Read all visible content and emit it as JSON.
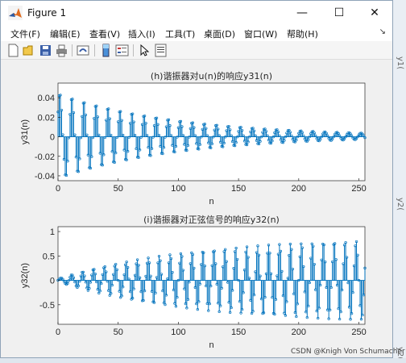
{
  "window": {
    "title": "Figure 1",
    "controls": [
      "—",
      "☐",
      "✕"
    ]
  },
  "menu": {
    "items": [
      "文件(F)",
      "编辑(E)",
      "查看(V)",
      "插入(I)",
      "工具(T)",
      "桌面(D)",
      "窗口(W)",
      "帮助(H)"
    ],
    "dock_glyph": "↘"
  },
  "toolbar": {
    "icons": [
      "new-figure-icon",
      "open-file-icon",
      "save-icon",
      "print-icon",
      "link-plot-icon",
      "insert-colorbar-icon",
      "insert-legend-icon",
      "pointer-icon",
      "property-editor-icon"
    ]
  },
  "background": {
    "right_labels": [
      "y1(",
      "y2(",
      "y2("
    ],
    "watermark": "CSDN @Knigh Von Schumacher"
  },
  "colors": {
    "stem": "#0072bd"
  },
  "chart_data": [
    {
      "type": "stem",
      "title": "(h)谐振器对u(n)的响应y31(n)",
      "xlabel": "n",
      "ylabel": "y31(n)",
      "xlim": [
        0,
        255
      ],
      "ylim": [
        -0.045,
        0.055
      ],
      "xticks": [
        0,
        50,
        100,
        150,
        200,
        250
      ],
      "yticks": [
        -0.04,
        -0.02,
        0,
        0.02,
        0.04
      ],
      "ytick_labels": [
        "-0.04",
        "-0.02",
        "0",
        "0.02",
        "0.04"
      ],
      "series": [
        {
          "formula": "y31(n) = 0.00495*(1 - cos(0.4*pi*n)) + 0.045*sin(0.4*pi*n)*0.9895^n  (approx. read from plot)",
          "n_range": [
            0,
            255
          ],
          "values_note": "damped oscillation, amplitude ≈0.045 near n=5 decaying to ≈0.005 at n=255"
        }
      ]
    },
    {
      "type": "stem",
      "title": "(i)谐振器对正弦信号的响应y32(n)",
      "xlabel": "n",
      "ylabel": "y32(n)",
      "xlim": [
        0,
        255
      ],
      "ylim": [
        -0.9,
        1.1
      ],
      "xticks": [
        0,
        50,
        100,
        150,
        200,
        250
      ],
      "yticks": [
        -0.5,
        0,
        0.5,
        1
      ],
      "ytick_labels": [
        "-0.5",
        "0",
        "0.5",
        "1"
      ],
      "series": [
        {
          "values_note": "growing oscillation, envelope rising from ≈0.03 at n=0 to ≈0.9 near n=250"
        }
      ]
    }
  ]
}
